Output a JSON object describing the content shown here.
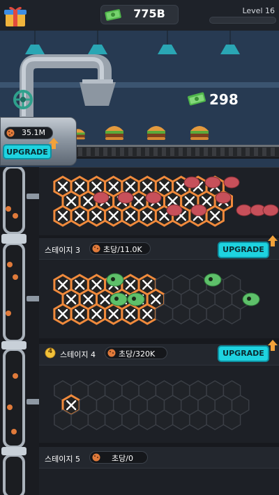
{
  "header": {
    "cash": "775B",
    "level": "Level 16",
    "level_progress": 0.0
  },
  "factory": {
    "profit": "298",
    "burgers_on_conveyor": 4
  },
  "tank": {
    "amount": "35.1M",
    "upgrade_label": "UPGRADE"
  },
  "stages": [
    {
      "label": "스테이지 3",
      "rate": "초당/11.0K",
      "upgrade_label": "UPGRADE"
    },
    {
      "label": "스테이지 4",
      "medal_number": "4",
      "rate": "초당/320K",
      "upgrade_label": "UPGRADE"
    },
    {
      "label": "스테이지 5",
      "rate": "초당/0"
    }
  ],
  "colors": {
    "accent": "#1ed3e0",
    "hex_active": "#f08a3c",
    "hex_inactive": "#3a3e45",
    "background": "#17191e"
  },
  "icons": {
    "gift": "gift-box-icon",
    "cash": "money-stack-icon",
    "cookie": "cookie-icon",
    "upgrade_arrow": "arrow-up-icon",
    "medal": "medal-icon",
    "grinder": "grinder-blade-icon",
    "alien": "alien-creature-icon",
    "meat": "meat-chunk-icon",
    "burger": "burger-icon"
  }
}
